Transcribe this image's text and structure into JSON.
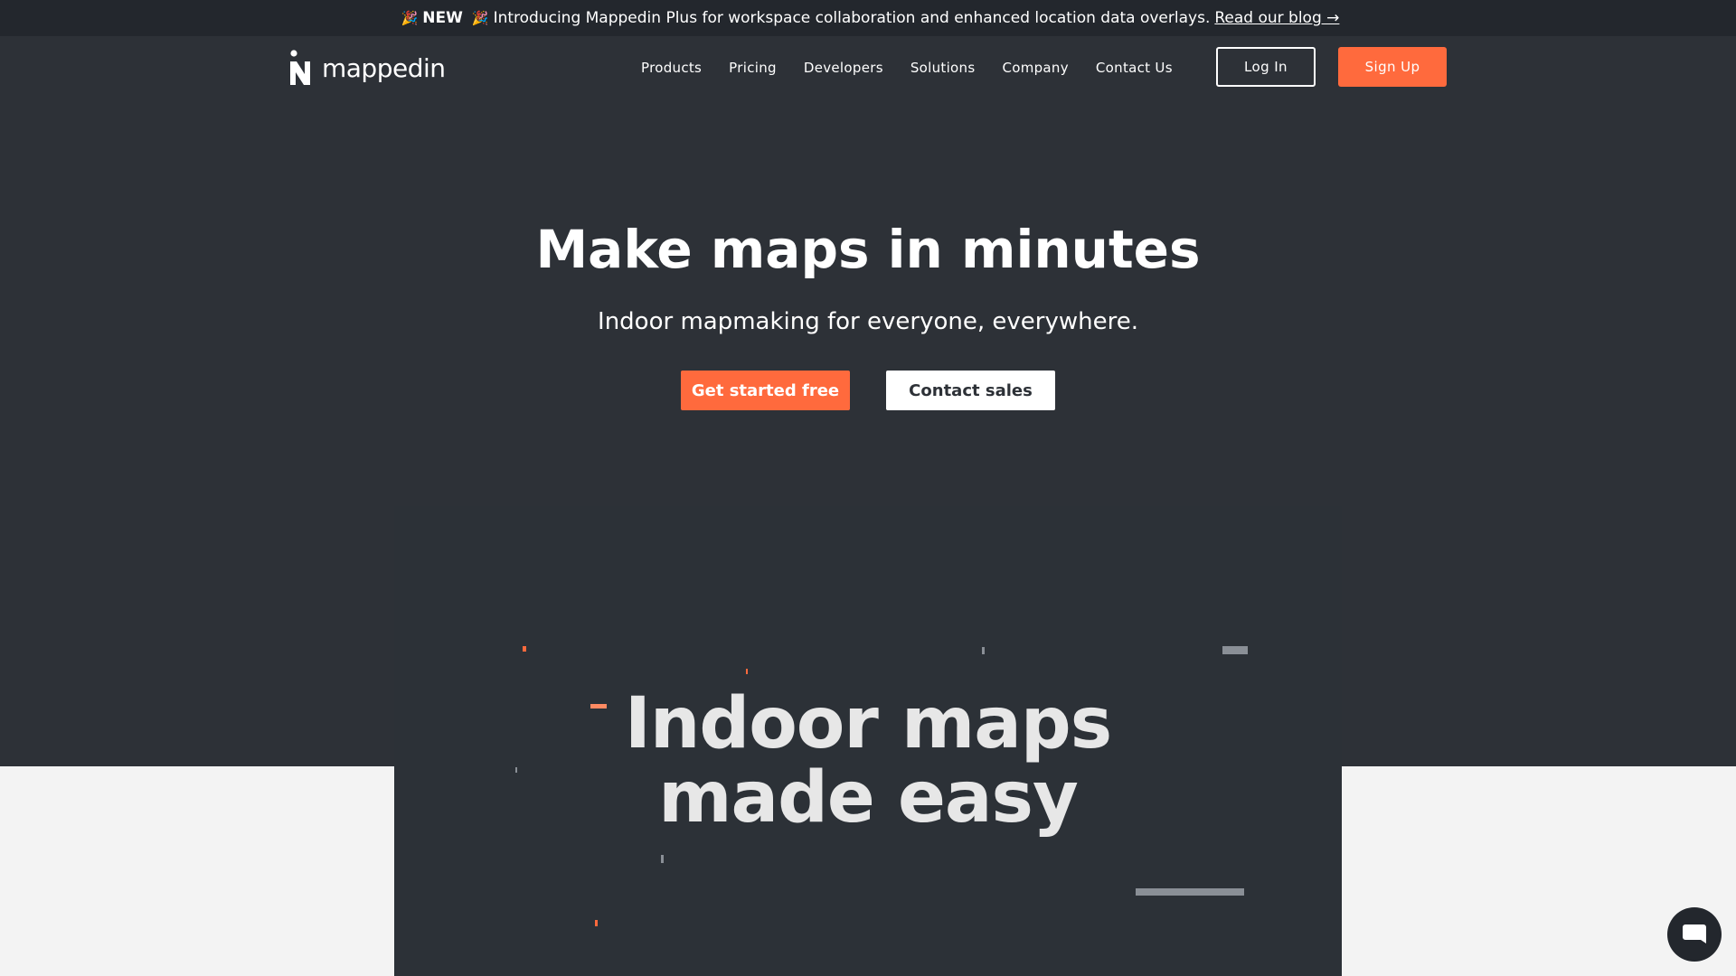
{
  "announcement": {
    "emoji": "🎉",
    "badge": "NEW",
    "text": "Introducing Mappedin Plus for workspace collaboration and enhanced location data overlays.",
    "link": "Read our blog →"
  },
  "header": {
    "logo_text": "mappedin",
    "nav": [
      "Products",
      "Pricing",
      "Developers",
      "Solutions",
      "Company",
      "Contact Us"
    ],
    "login_label": "Log In",
    "signup_label": "Sign Up"
  },
  "hero": {
    "title": "Make maps in minutes",
    "subtitle": "Indoor mapmaking for everyone, everywhere.",
    "primary_cta": "Get started free",
    "secondary_cta": "Contact sales"
  },
  "showcase": {
    "line1": "Indoor maps",
    "line2": "made easy"
  },
  "colors": {
    "accent": "#ff6a3d",
    "background": "#2d3137",
    "topbar": "#23272d",
    "light_section": "#f3f3f3"
  },
  "icons": {
    "chat": "chat-bubble-icon",
    "logo": "mappedin-logo-mark"
  }
}
